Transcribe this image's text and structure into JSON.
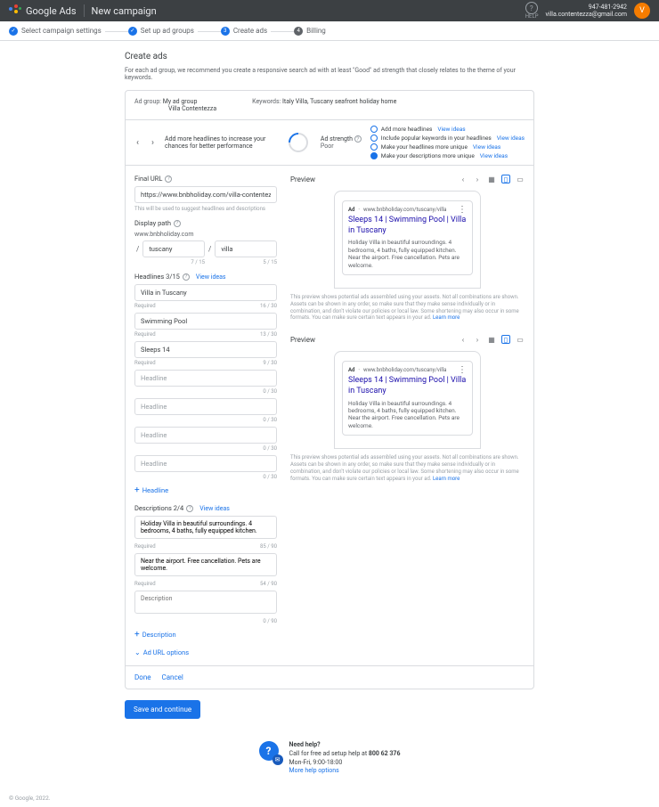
{
  "header": {
    "brand": "Google Ads",
    "page": "New campaign",
    "help": "HELP",
    "phone": "947-481-2942",
    "email": "villa.contentezza@gmail.com",
    "avatar": "V"
  },
  "steps": [
    {
      "num": "✓",
      "label": "Select campaign settings"
    },
    {
      "num": "✓",
      "label": "Set up ad groups"
    },
    {
      "num": "3",
      "label": "Create ads"
    },
    {
      "num": "4",
      "label": "Billing"
    }
  ],
  "section": {
    "title": "Create ads",
    "sub": "For each ad group, we recommend you create a responsive search ad with at least \"Good\" ad strength that closely relates to the theme of your keywords."
  },
  "adgroup": {
    "label": "Ad group:",
    "name": "My ad group",
    "sub": "Villa Contentezza",
    "kwlabel": "Keywords:",
    "keywords": "Italy Villa, Tuscany seafront holiday home"
  },
  "hint": {
    "text": "Add more headlines to increase your chances for better performance",
    "strength_label": "Ad strength",
    "strength_value": "Poor"
  },
  "suggestions": [
    {
      "text": "Add more headlines",
      "link": "View ideas",
      "filled": false
    },
    {
      "text": "Include popular keywords in your headlines",
      "link": "View ideas",
      "filled": false
    },
    {
      "text": "Make your headlines more unique",
      "link": "View ideas",
      "filled": false
    },
    {
      "text": "Make your descriptions more unique",
      "link": "View ideas",
      "filled": true
    }
  ],
  "final_url": {
    "label": "Final URL",
    "value": "https://www.bnbholiday.com/villa-contentezza",
    "helper": "This will be used to suggest headlines and descriptions"
  },
  "display_path": {
    "label": "Display path",
    "base": "www.bnbholiday.com",
    "p1": "tuscany",
    "c1": "7 / 15",
    "p2": "villa",
    "c2": "5 / 15"
  },
  "headlines": {
    "label": "Headlines 3/15",
    "view": "View ideas",
    "required": "Required",
    "items": [
      {
        "value": "Villa in Tuscany",
        "counter": "16 / 30"
      },
      {
        "value": "Swimming Pool",
        "counter": "13 / 30"
      },
      {
        "value": "Sleeps 14",
        "counter": "9 / 30"
      },
      {
        "value": "",
        "counter": "0 / 30",
        "ph": "Headline"
      },
      {
        "value": "",
        "counter": "0 / 30",
        "ph": "Headline"
      },
      {
        "value": "",
        "counter": "0 / 30",
        "ph": "Headline"
      },
      {
        "value": "",
        "counter": "0 / 30",
        "ph": "Headline"
      }
    ],
    "add": "Headline"
  },
  "descriptions": {
    "label": "Descriptions 2/4",
    "view": "View ideas",
    "required": "Required",
    "items": [
      {
        "value": "Holiday Villa in beautiful surroundings. 4 bedrooms, 4 baths, fully equipped kitchen.",
        "counter": "85 / 90"
      },
      {
        "value": "Near the airport. Free cancellation. Pets are welcome.",
        "counter": "54 / 90"
      },
      {
        "value": "",
        "counter": "0 / 90",
        "ph": "Description"
      }
    ],
    "add": "Description"
  },
  "url_options": "Ad URL options",
  "preview": {
    "label": "Preview",
    "url": "www.bnbholiday.com/tuscany/villa",
    "title": "Sleeps 14 | Swimming Pool | Villa in Tuscany",
    "desc": "Holiday Villa in beautiful surroundings. 4 bedrooms, 4 baths, fully equipped kitchen. Near the airport. Free cancellation. Pets are welcome.",
    "note": "This preview shows potential ads assembled using your assets. Not all combinations are shown. Assets can be shown in any order, so make sure that they make sense individually or in combination, and don't violate our policies or local law. Some shortening may also occur in some formats. You can make sure certain text appears in your ad.",
    "learn": "Learn more"
  },
  "footer": {
    "done": "Done",
    "cancel": "Cancel",
    "save": "Save and continue"
  },
  "help_section": {
    "title": "Need help?",
    "line1a": "Call for free ad setup help at ",
    "phone": "800 62 376",
    "line2": "Mon-Fri, 9:00-18:00",
    "more": "More help options"
  },
  "copyright": "© Google, 2022."
}
